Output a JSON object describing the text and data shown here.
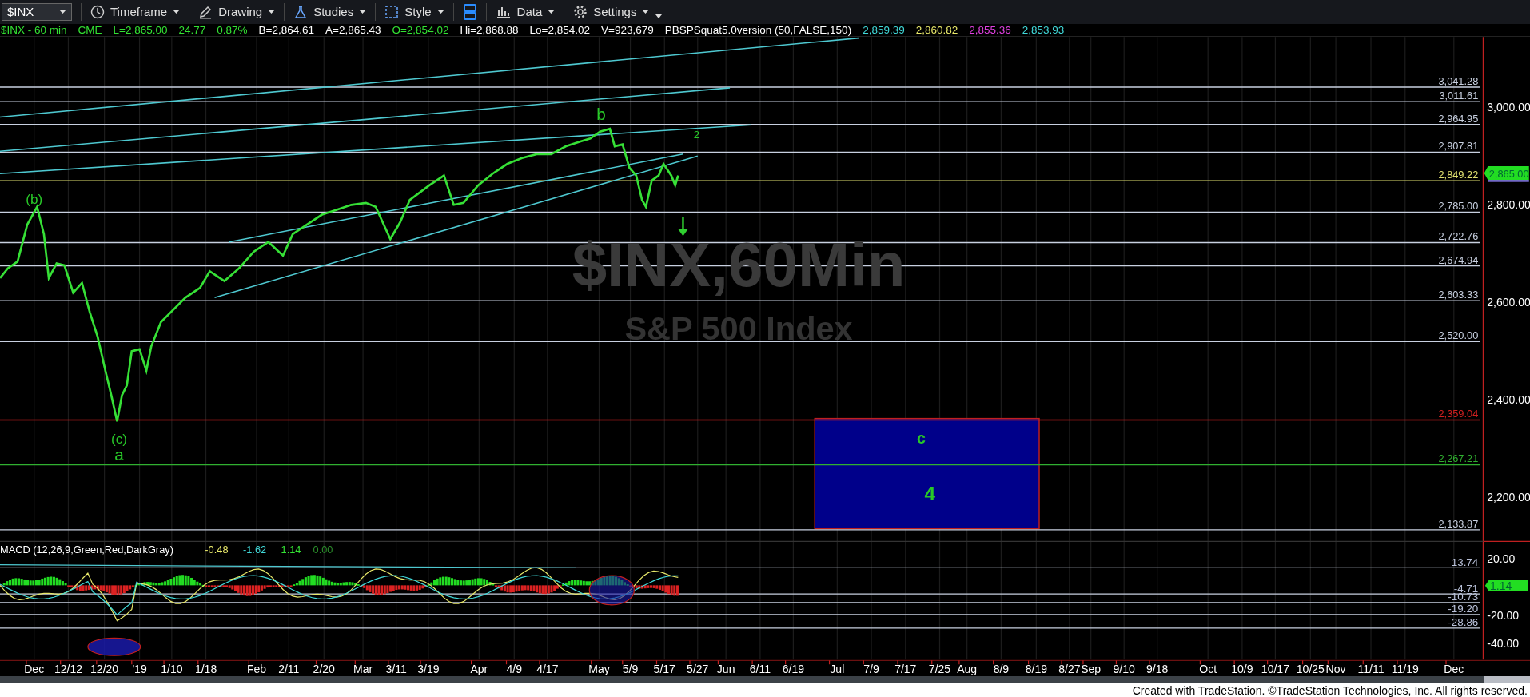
{
  "symbol_box": {
    "value": "$INX"
  },
  "toolbar": [
    {
      "kind": "menu",
      "label": "Timeframe"
    },
    {
      "kind": "menu",
      "label": "Drawing"
    },
    {
      "kind": "menu",
      "label": "Studies"
    },
    {
      "kind": "menu",
      "label": "Style"
    },
    {
      "kind": "icon"
    },
    {
      "kind": "menu",
      "label": "Data"
    },
    {
      "kind": "menu",
      "label": "Settings"
    }
  ],
  "legend": [
    {
      "text": "$INX - 60 min",
      "color": "#33e233"
    },
    {
      "text": "CME",
      "color": "#33e233"
    },
    {
      "text": "L=2,865.00",
      "color": "#33e233"
    },
    {
      "text": "24.77",
      "color": "#33e233"
    },
    {
      "text": "0.87%",
      "color": "#33e233"
    },
    {
      "text": "B=2,864.61",
      "color": "#ffffff"
    },
    {
      "text": "A=2,865.43",
      "color": "#ffffff"
    },
    {
      "text": "O=2,854.02",
      "color": "#33e233"
    },
    {
      "text": "Hi=2,868.88",
      "color": "#ffffff"
    },
    {
      "text": "Lo=2,854.02",
      "color": "#ffffff"
    },
    {
      "text": "V=923,679",
      "color": "#ffffff"
    },
    {
      "text": "PBSPSquat5.0version (50,FALSE,150)",
      "color": "#ffffff"
    },
    {
      "text": "2,859.39",
      "color": "#40d8d8"
    },
    {
      "text": "2,860.82",
      "color": "#e8e86a"
    },
    {
      "text": "2,855.36",
      "color": "#e040e0"
    },
    {
      "text": "2,853.93",
      "color": "#40d8d8"
    }
  ],
  "chart": {
    "watermark": {
      "title": "$INX,60Min",
      "subtitle": "S&P 500 Index"
    },
    "levels": [
      {
        "label": "3,041.28",
        "color": "#c8d0e0"
      },
      {
        "label": "3,011.61",
        "color": "#c8d0e0"
      },
      {
        "label": "2,964.95",
        "color": "#c8d0e0"
      },
      {
        "label": "2,907.81",
        "color": "#c8d0e0"
      },
      {
        "label": "2,849.22",
        "color": "#e0e070"
      },
      {
        "label": "2,785.00",
        "color": "#c8d0e0"
      },
      {
        "label": "2,722.76",
        "color": "#c8d0e0"
      },
      {
        "label": "2,674.94",
        "color": "#c8d0e0"
      },
      {
        "label": "2,603.33",
        "color": "#c8d0e0"
      },
      {
        "label": "2,520.00",
        "color": "#c8d0e0"
      },
      {
        "label": "2,359.04",
        "color": "#d02020"
      },
      {
        "label": "2,267.21",
        "color": "#30b030"
      },
      {
        "label": "2,133.87",
        "color": "#c8d0e0"
      }
    ],
    "price_axis": [
      "3,000.00",
      "2,800.00",
      "2,600.00",
      "2,400.00",
      "2,200.00"
    ],
    "last_price": "2,865.00",
    "wave_labels": [
      {
        "text": "(b)"
      },
      {
        "text": "(c)"
      },
      {
        "text": "a"
      },
      {
        "text": "b"
      },
      {
        "text": "2"
      },
      {
        "text": "c"
      },
      {
        "text": "4"
      }
    ],
    "macd": {
      "legend": [
        {
          "text": "MACD (12,26,9,Green,Red,DarkGray)",
          "color": "#ffffff"
        },
        {
          "text": "-0.48",
          "color": "#e8e86a"
        },
        {
          "text": "-1.62",
          "color": "#40d8d8"
        },
        {
          "text": "1.14",
          "color": "#33e233"
        },
        {
          "text": "0.00",
          "color": "#2a8a2a"
        }
      ],
      "levels": [
        "13.74",
        "-4.71",
        "-10.73",
        "-19.20",
        "-28.86"
      ],
      "axis": [
        "20.00",
        "-20.00",
        "-40.00"
      ],
      "last_value": "1.14"
    },
    "time_axis": [
      "Dec",
      "12/12",
      "12/20",
      "'19",
      "1/10",
      "1/18",
      "Feb",
      "2/11",
      "2/20",
      "Mar",
      "3/11",
      "3/19",
      "Apr",
      "4/9",
      "4/17",
      "May",
      "5/9",
      "5/17",
      "5/27",
      "Jun",
      "6/11",
      "6/19",
      "Jul",
      "7/9",
      "7/17",
      "7/25",
      "Aug",
      "8/9",
      "8/19",
      "8/27",
      "Sep",
      "9/10",
      "9/18",
      "Oct",
      "10/9",
      "10/17",
      "10/25",
      "Nov",
      "11/11",
      "11/19",
      "Dec"
    ]
  },
  "footer": "Created with TradeStation. ©TradeStation Technologies, Inc. All rights reserved."
}
